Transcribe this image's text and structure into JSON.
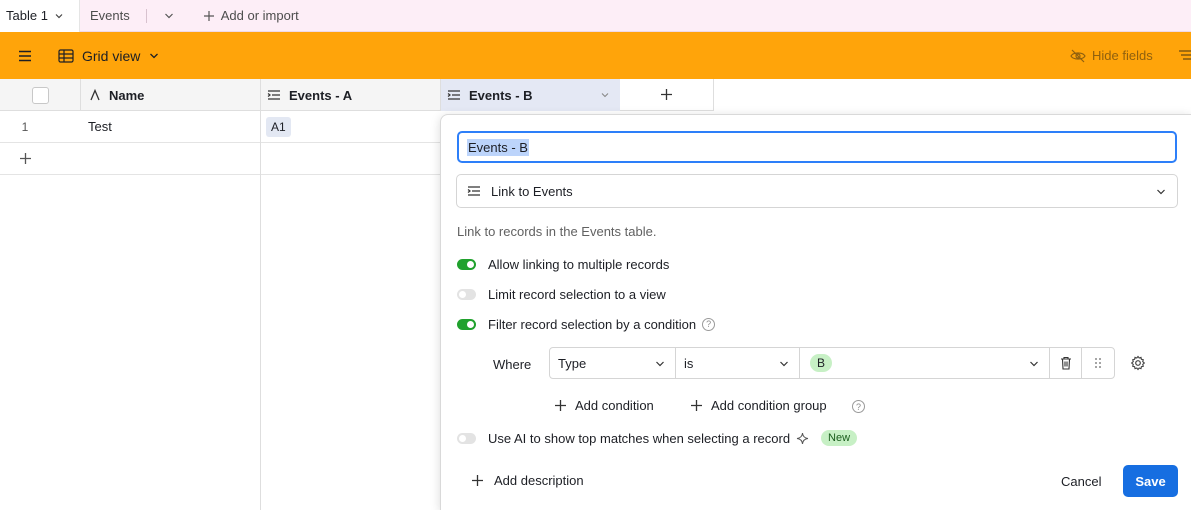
{
  "tabbar": {
    "active_table": "Table 1",
    "other_table": "Events",
    "add_import": "Add or import"
  },
  "toolbar": {
    "view_name": "Grid view",
    "hide_fields": "Hide fields"
  },
  "grid": {
    "columns": [
      "Name",
      "Events - A",
      "Events - B"
    ],
    "rows": [
      {
        "num": "1",
        "name": "Test",
        "events_a": "A1",
        "events_b": ""
      }
    ]
  },
  "field_editor": {
    "name_value": "Events - B",
    "field_type": "Link to Events",
    "help_text": "Link to records in the Events table.",
    "option_multiple": "Allow linking to multiple records",
    "option_multiple_on": true,
    "option_limit_view": "Limit record selection to a view",
    "option_limit_view_on": false,
    "option_filter": "Filter record selection by a condition",
    "option_filter_on": true,
    "where_label": "Where",
    "cond_field": "Type",
    "cond_op": "is",
    "cond_value": "B",
    "add_condition": "Add condition",
    "add_condition_group": "Add condition group",
    "option_ai": "Use AI to show top matches when selecting a record",
    "option_ai_on": false,
    "new_badge": "New",
    "add_description": "Add description",
    "cancel_label": "Cancel",
    "save_label": "Save"
  },
  "colors": {
    "toolbar_bg": "#ffa40a",
    "tabbar_bg": "#fdeef7",
    "primary": "#166ee1",
    "toggle_on": "#20a12d"
  }
}
